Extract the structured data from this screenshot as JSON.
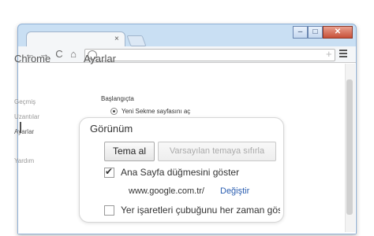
{
  "window": {
    "controls": {
      "minimize": "–",
      "maximize": "□",
      "close": "✕"
    }
  },
  "tab": {
    "close_glyph": "×"
  },
  "toolbar": {
    "back": "←",
    "forward": "→",
    "reload": "C",
    "home": "⌂",
    "bookmark_star": "+"
  },
  "sidebar": {
    "brand": "Chrome",
    "items": [
      {
        "label": "Geçmiş"
      },
      {
        "label": "Uzantılar"
      },
      {
        "label": "Ayarlar"
      },
      {
        "label": "Yardım"
      }
    ]
  },
  "main": {
    "title": "Ayarlar",
    "startup": {
      "heading": "Başlangıçta",
      "option_new_tab": "Yeni Sekme sayfasını aç"
    }
  },
  "appearance": {
    "title": "Görünüm",
    "get_themes_button": "Tema al",
    "reset_theme_button": "Varsayılan temaya sıfırla",
    "show_home_button_label": "Ana Sayfa düğmesini göster",
    "home_url": "www.google.com.tr/",
    "change_link": "Değiştir",
    "show_bookmarks_bar_label": "Yer işaretleri çubuğunu her zaman göster",
    "show_home_button_checked": true,
    "show_bookmarks_bar_checked": false
  },
  "colors": {
    "frame": "#c9dff3",
    "link": "#2a5db0",
    "close_button": "#c75038"
  }
}
